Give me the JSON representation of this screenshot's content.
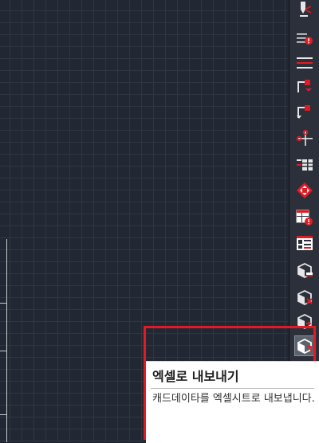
{
  "tooltip": {
    "title": "엑셀로 내보내기",
    "description": "캐드데이타를 엑셀시트로 내보냅니다."
  },
  "toolbar": {
    "active_tool": "export-to-excel",
    "tools": [
      "pen-move-tool-icon",
      "lines-alert-tool-icon",
      "dimension-lines-tool-icon",
      "corner-arrow-down-tool-icon",
      "corner-arrow-tool-icon",
      "point-crosshair-tool-icon",
      "grid-table-tool-icon",
      "diamond-grid-tool-icon",
      "table-alert-tool-icon",
      "table-calc-tool-icon",
      "cube-tool-icon",
      "cube-close-tool-icon",
      "cube-arrow-tool-icon",
      "excel-export-tool-icon"
    ]
  },
  "colors": {
    "canvas_bg": "#222833",
    "grid_line": "#2f3642",
    "toolbar_bg": "#2b303a",
    "accent_red": "#e31a24",
    "icon_white": "#e6e6e6"
  }
}
